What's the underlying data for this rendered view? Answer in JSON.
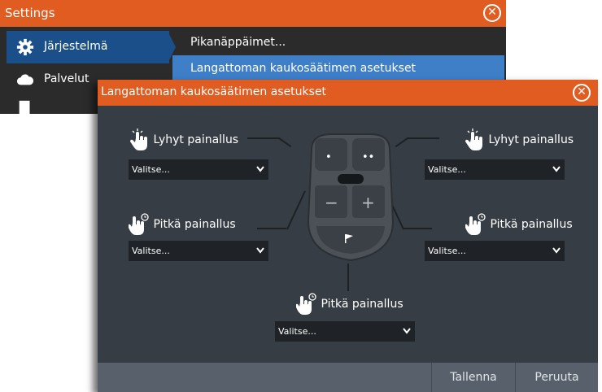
{
  "settings_window": {
    "title": "Settings",
    "sidebar": [
      {
        "label": "Järjestelmä",
        "icon": "gear-icon",
        "active": true
      },
      {
        "label": "Palvelut",
        "icon": "cloud-icon",
        "active": false
      },
      {
        "label": "",
        "icon": "document-icon",
        "active": false
      }
    ],
    "menu": [
      {
        "label": "Pikanäppäimet..."
      },
      {
        "label": "Langattoman kaukosäätimen asetukset"
      }
    ]
  },
  "dialog": {
    "title": "Langattoman kaukosäätimen asetukset",
    "assignments": [
      {
        "id": "top-left",
        "label": "Lyhyt painallus",
        "icon": "tap-hand-icon",
        "value": "Valitse..."
      },
      {
        "id": "top-right",
        "label": "Lyhyt painallus",
        "icon": "tap-hand-icon",
        "value": "Valitse..."
      },
      {
        "id": "mid-left",
        "label": "Pitkä painallus",
        "icon": "long-press-hand-icon",
        "value": "Valitse..."
      },
      {
        "id": "mid-right",
        "label": "Pitkä painallus",
        "icon": "long-press-hand-icon",
        "value": "Valitse..."
      },
      {
        "id": "bottom",
        "label": "Pitkä painallus",
        "icon": "long-press-hand-icon",
        "value": "Valitse..."
      }
    ],
    "remote": {
      "buttons": [
        "•",
        "••",
        "−",
        "+",
        "flag-icon"
      ]
    },
    "footer": {
      "save_label": "Tallenna",
      "cancel_label": "Peruuta"
    }
  },
  "colors": {
    "titlebar": "#e05c21",
    "selection": "#3e7fc8",
    "dialog_bg": "#363d44",
    "footer_bg": "#58616b"
  }
}
